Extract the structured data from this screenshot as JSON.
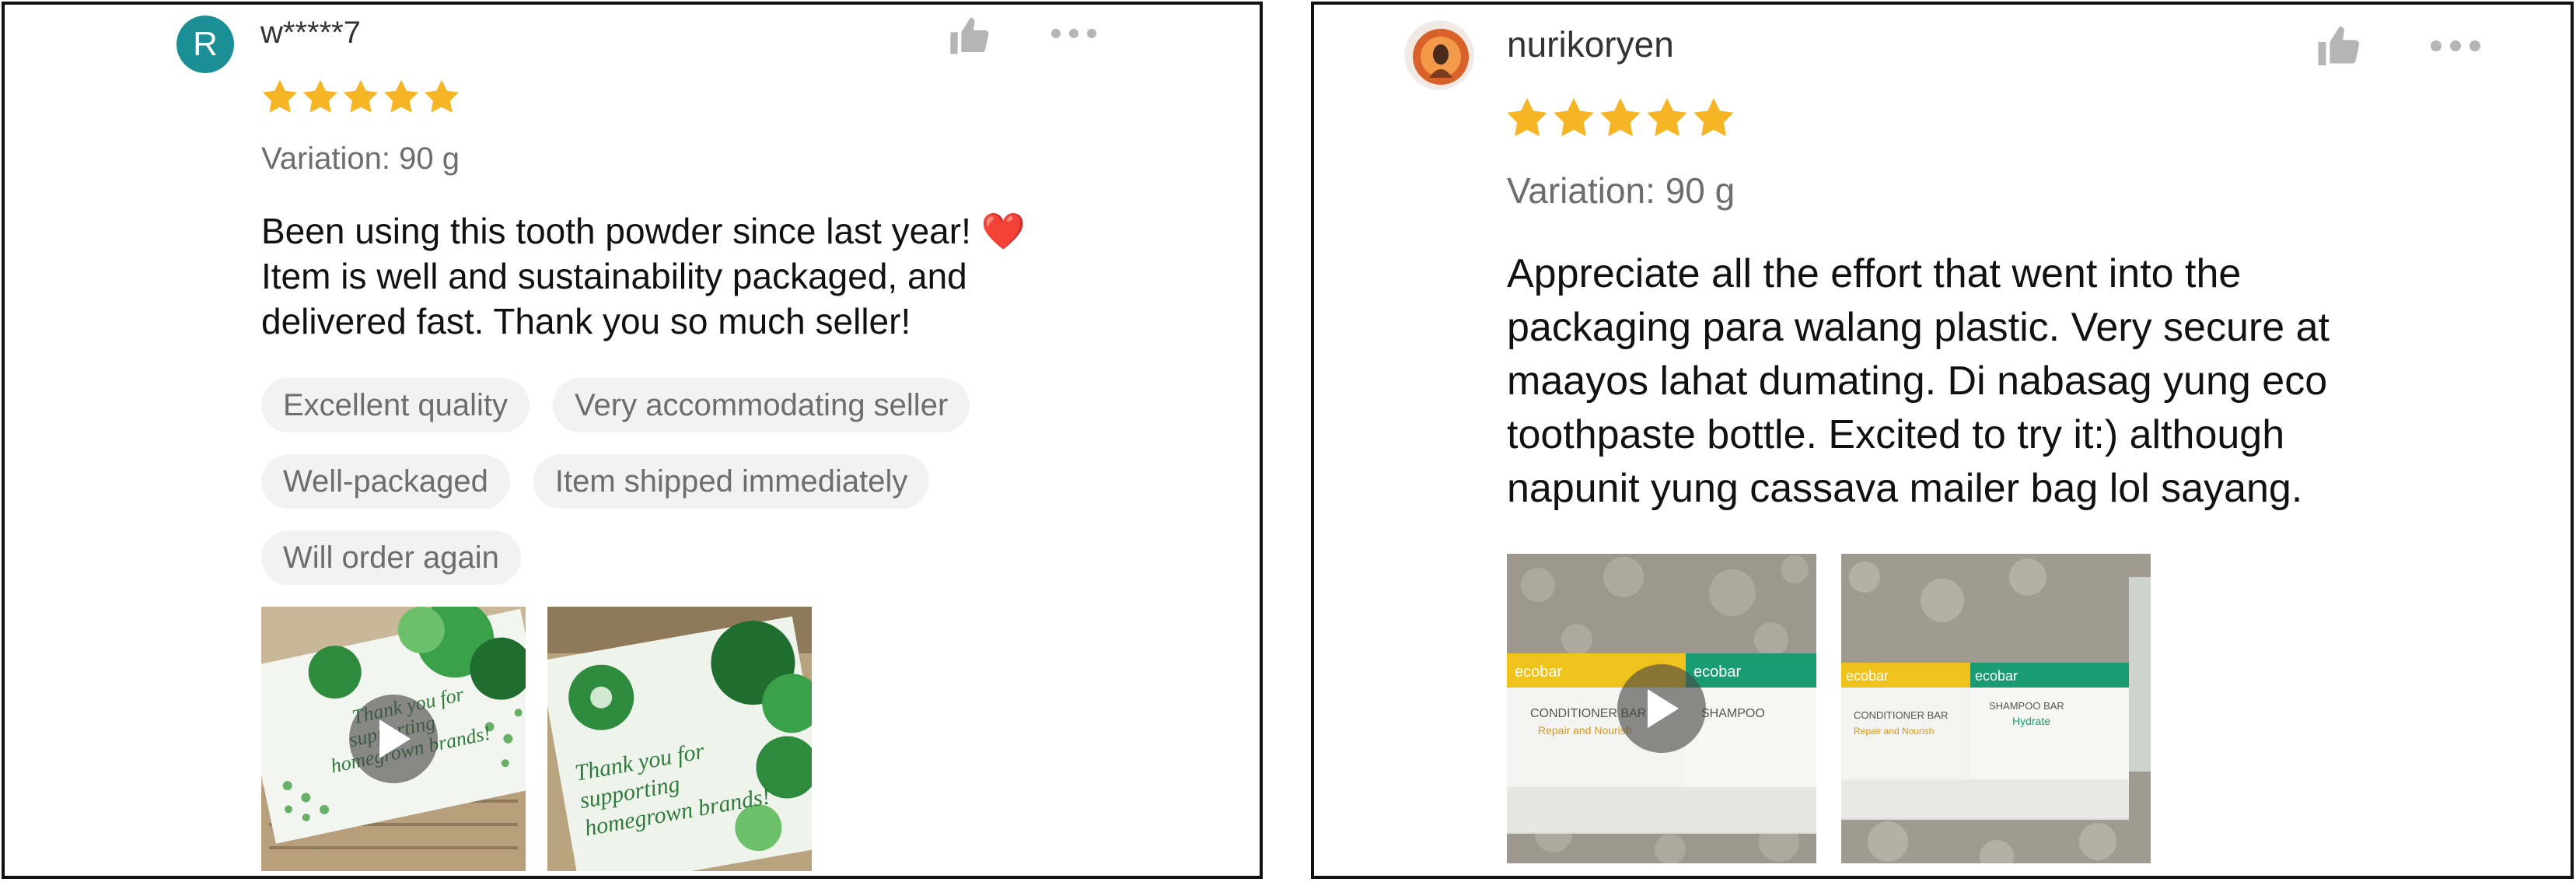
{
  "reviews": [
    {
      "username": "w*****7",
      "avatar_letter": "R",
      "rating": 5,
      "variation": "Variation: 90 g",
      "text_lines": [
        "Been using this tooth powder since last year! ❤️",
        "Item is well and sustainability packaged, and",
        "delivered fast. Thank you so much seller!"
      ],
      "tags": [
        "Excellent quality",
        "Very accommodating seller",
        "Well-packaged",
        "Item shipped immediately",
        "Will order again"
      ],
      "media": [
        {
          "kind": "video",
          "depicts": "thank-you card with green leaf pattern"
        },
        {
          "kind": "image",
          "depicts": "thank-you card with green leaf pattern"
        }
      ],
      "card_text": "Thank you for supporting homegrown brands!"
    },
    {
      "username": "nurikoryen",
      "rating": 5,
      "variation": "Variation: 90 g",
      "text_lines": [
        "Appreciate all the effort that went into the",
        "packaging para walang plastic. Very secure at",
        "maayos lahat dumating. Di nabasag yung eco",
        "toothpaste bottle. Excited to try it:) although",
        "napunit yung cassava mailer bag lol sayang."
      ],
      "media": [
        {
          "kind": "video",
          "depicts": "ecobar conditioner and shampoo bar boxes"
        },
        {
          "kind": "image",
          "depicts": "ecobar conditioner and shampoo bar boxes"
        }
      ],
      "box_labels": [
        "ecobar",
        "CONDITIONER BAR",
        "SHAMPOO BAR",
        "Repair and Nourish",
        "Hydrate"
      ]
    }
  ],
  "icons": {
    "like": "thumbs-up-icon",
    "more": "more-options-icon",
    "play": "play-icon",
    "star": "star-icon"
  },
  "colors": {
    "star": "#F6B524",
    "avatar_bg": "#1A8F96",
    "tag_bg": "#F2F2F2",
    "tag_text": "#6D6D6D",
    "icon": "#B5B5B5"
  }
}
